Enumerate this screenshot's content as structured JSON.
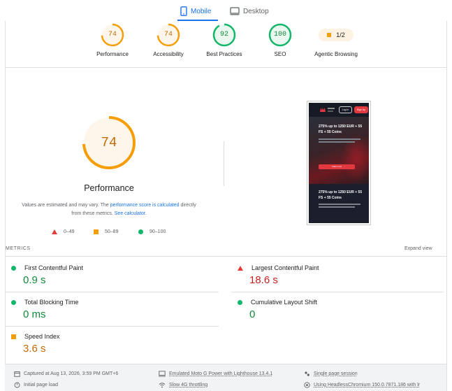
{
  "device_tabs": {
    "mobile": "Mobile",
    "desktop": "Desktop",
    "active": "Mobile"
  },
  "gauges": [
    {
      "score": "74",
      "label": "Performance",
      "color": "#f59e0b",
      "fraction": 0.74
    },
    {
      "score": "74",
      "label": "Accessibility",
      "color": "#f59e0b",
      "fraction": 0.74
    },
    {
      "score": "92",
      "label": "Best Practices",
      "color": "#12b76a",
      "fraction": 0.92
    },
    {
      "score": "100",
      "label": "SEO",
      "color": "#12b76a",
      "fraction": 1.0
    }
  ],
  "agentic": {
    "value": "1/2",
    "label": "Agentic Browsing"
  },
  "performance": {
    "score": "74",
    "fraction": 0.74,
    "title": "Performance",
    "note_prefix": "Values are estimated and may vary. The ",
    "note_link1": "performance score is calculated",
    "note_middle": " directly from these metrics. ",
    "note_link2": "See calculator."
  },
  "legend": {
    "poor": "0–49",
    "average": "50–89",
    "good": "90–100"
  },
  "thumbnail": {
    "login": "Log In",
    "signup": "Sign Up",
    "headline1": "275% up to 1250 EUR + 55 FS + 55 Coins",
    "button": "Claim now",
    "headline2": "275% up to 1250 EUR + 55 FS + 55 Coins"
  },
  "metrics": {
    "header": "METRICS",
    "expand": "Expand view",
    "items": [
      {
        "label": "First Contentful Paint",
        "value": "0.9 s",
        "rating": "good"
      },
      {
        "label": "Largest Contentful Paint",
        "value": "18.6 s",
        "rating": "poor"
      },
      {
        "label": "Total Blocking Time",
        "value": "0 ms",
        "rating": "good"
      },
      {
        "label": "Cumulative Layout Shift",
        "value": "0",
        "rating": "good"
      },
      {
        "label": "Speed Index",
        "value": "3.6 s",
        "rating": "average"
      }
    ]
  },
  "footer": {
    "captured": "Captured at Aug 13, 2026, 3:59 PM GMT+6",
    "emulated": "Emulated Moto G Power with Lighthouse 13.4.1",
    "session": "Single page session",
    "initial": "Initial page load",
    "throttling": "Slow 4G throttling",
    "browser": "Using HeadlessChromium 150.0.7871.186 with lr"
  },
  "colors": {
    "accent": "#1a73e8",
    "good": "#12b76a",
    "average": "#f59e0b",
    "poor": "#e53935"
  }
}
